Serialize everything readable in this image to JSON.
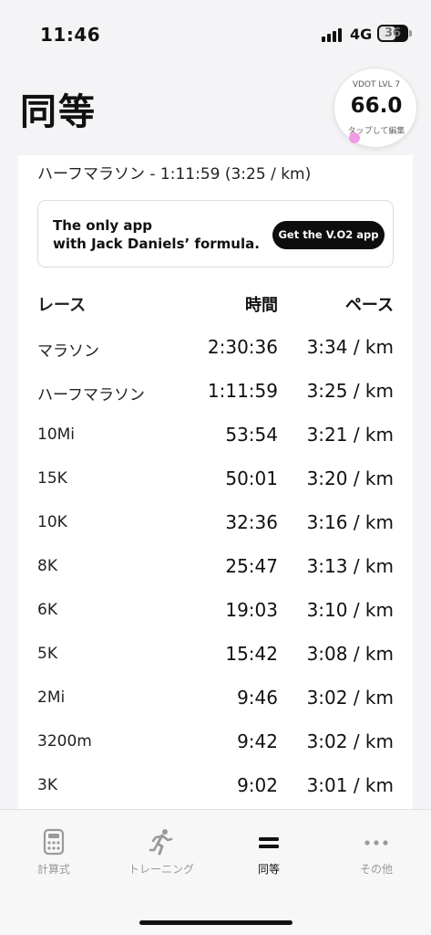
{
  "status": {
    "time": "11:46",
    "network": "4G",
    "battery": "36"
  },
  "header": {
    "title": "同等"
  },
  "vdot": {
    "label": "VDOT LVL 7",
    "value": "66.0",
    "hint": "タップして編集"
  },
  "subtitle": "ハーフマラソン - 1:11:59 (3:25 / km)",
  "promo": {
    "line1": "The only app",
    "line2": "with Jack Daniels’ formula.",
    "cta": "Get the V.O2 app"
  },
  "table": {
    "headers": {
      "race": "レース",
      "time": "時間",
      "pace": "ペース"
    },
    "rows": [
      {
        "race": "マラソン",
        "time": "2:30:36",
        "pace": "3:34 / km"
      },
      {
        "race": "ハーフマラソン",
        "time": "1:11:59",
        "pace": "3:25 / km"
      },
      {
        "race": "10Mi",
        "time": "53:54",
        "pace": "3:21 / km"
      },
      {
        "race": "15K",
        "time": "50:01",
        "pace": "3:20 / km"
      },
      {
        "race": "10K",
        "time": "32:36",
        "pace": "3:16 / km"
      },
      {
        "race": "8K",
        "time": "25:47",
        "pace": "3:13 / km"
      },
      {
        "race": "6K",
        "time": "19:03",
        "pace": "3:10 / km"
      },
      {
        "race": "5K",
        "time": "15:42",
        "pace": "3:08 / km"
      },
      {
        "race": "2Mi",
        "time": "9:46",
        "pace": "3:02 / km"
      },
      {
        "race": "3200m",
        "time": "9:42",
        "pace": "3:02 / km"
      },
      {
        "race": "3K",
        "time": "9:02",
        "pace": "3:01 / km"
      }
    ]
  },
  "tabs": [
    {
      "label": "計算式",
      "icon": "calculator-icon",
      "active": false
    },
    {
      "label": "トレーニング",
      "icon": "runner-icon",
      "active": false
    },
    {
      "label": "同等",
      "icon": "equals-icon",
      "active": true
    },
    {
      "label": "その他",
      "icon": "more-dots-icon",
      "active": false
    }
  ],
  "colors": {
    "accent_dot": "#f19ae6",
    "cta_bg": "#0d0d0d",
    "tab_inactive": "#999999"
  }
}
